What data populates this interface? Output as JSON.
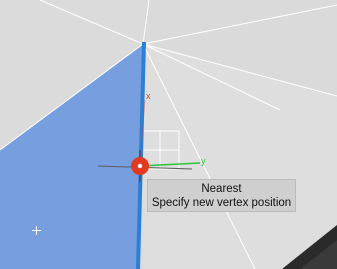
{
  "viewport": {
    "background": "#dadada",
    "face_selected_color": "#779fe0",
    "edge_color": "#2d7fd3",
    "vertex_marker_color": "#e03a22",
    "dark_region_color": "#2a2a2a"
  },
  "gizmo": {
    "x_axis_label": "x",
    "y_axis_label": "y",
    "x_axis_color": "#e0412a",
    "y_axis_color": "#2fc43a"
  },
  "tooltip": {
    "snap_mode": "Nearest",
    "prompt": "Specify new vertex position"
  }
}
